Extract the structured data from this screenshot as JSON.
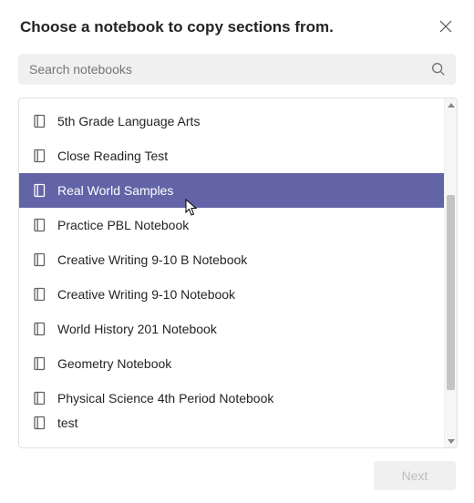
{
  "header": {
    "title": "Choose a notebook to copy sections from."
  },
  "search": {
    "placeholder": "Search notebooks"
  },
  "notebooks": [
    {
      "label": "5th Grade Language Arts",
      "selected": false
    },
    {
      "label": "Close Reading Test",
      "selected": false
    },
    {
      "label": "Real World Samples",
      "selected": true
    },
    {
      "label": "Practice PBL Notebook",
      "selected": false
    },
    {
      "label": "Creative Writing 9-10 B Notebook",
      "selected": false
    },
    {
      "label": "Creative Writing 9-10 Notebook",
      "selected": false
    },
    {
      "label": "World History 201 Notebook",
      "selected": false
    },
    {
      "label": "Geometry Notebook",
      "selected": false
    },
    {
      "label": "Physical Science 4th Period Notebook",
      "selected": false
    },
    {
      "label": "test",
      "selected": false
    }
  ],
  "footer": {
    "next_label": "Next"
  },
  "colors": {
    "accent": "#6264a7"
  }
}
